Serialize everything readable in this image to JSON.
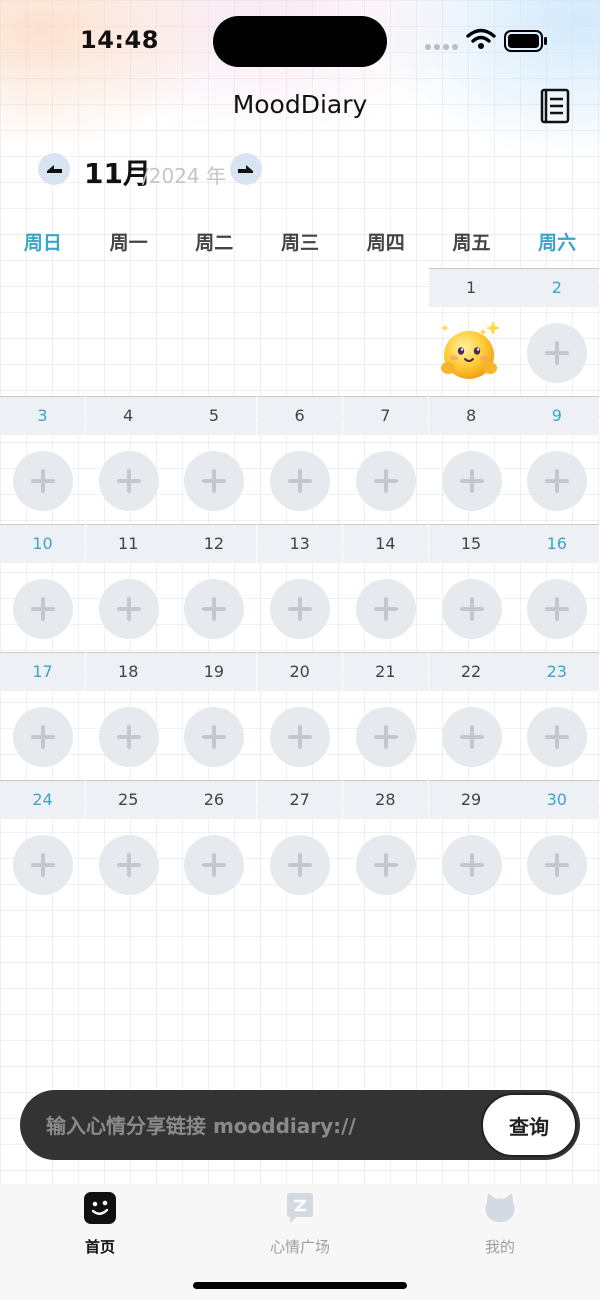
{
  "status_bar": {
    "time": "14:48"
  },
  "header": {
    "title": "MoodDiary",
    "notes_icon": "notebook-icon"
  },
  "month_nav": {
    "month": "11月",
    "year": "/2024 年",
    "prev_icon": "arrow-left-icon",
    "next_icon": "arrow-right-icon"
  },
  "weekdays": [
    "周日",
    "周一",
    "周二",
    "周三",
    "周四",
    "周五",
    "周六"
  ],
  "calendar": {
    "weeks": [
      [
        "",
        "",
        "",
        "",
        "",
        "1",
        "2"
      ],
      [
        "3",
        "4",
        "5",
        "6",
        "7",
        "8",
        "9"
      ],
      [
        "10",
        "11",
        "12",
        "13",
        "14",
        "15",
        "16"
      ],
      [
        "17",
        "18",
        "19",
        "20",
        "21",
        "22",
        "23"
      ],
      [
        "24",
        "25",
        "26",
        "27",
        "28",
        "29",
        "30"
      ]
    ],
    "mood_entries": {
      "1": "happy-sparkle-emoji"
    },
    "add_icon": "plus-icon"
  },
  "search": {
    "placeholder": "输入心情分享链接 mooddiary://",
    "button": "查询"
  },
  "tabs": [
    {
      "label": "首页",
      "icon": "home-face-icon",
      "active": true
    },
    {
      "label": "心情广场",
      "icon": "mood-square-icon",
      "active": false
    },
    {
      "label": "我的",
      "icon": "cat-profile-icon",
      "active": false
    }
  ],
  "colors": {
    "weekend": "#3aa5c5",
    "search_bar": "#333333",
    "add_button": "#e6e9ee"
  }
}
